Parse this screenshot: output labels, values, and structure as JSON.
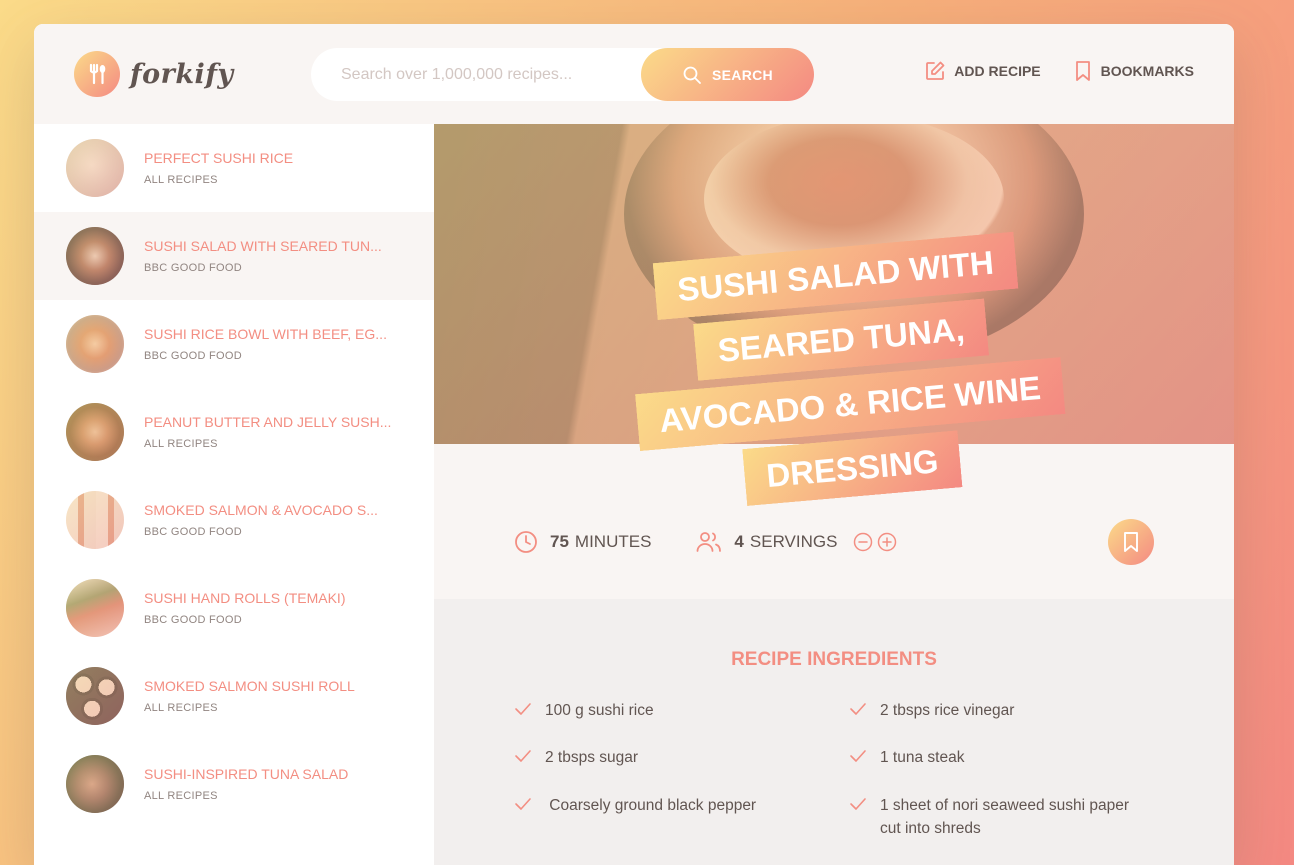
{
  "app": {
    "name": "forkify"
  },
  "colors": {
    "accent": "#f38e82",
    "gradient_start": "#fbdb89",
    "gradient_end": "#f48982",
    "text": "#615551"
  },
  "search": {
    "placeholder": "Search over 1,000,000 recipes...",
    "value": "",
    "button_label": "SEARCH",
    "icon": "search-icon"
  },
  "nav": [
    {
      "label": "ADD RECIPE",
      "icon": "edit-icon"
    },
    {
      "label": "BOOKMARKS",
      "icon": "bookmark-icon"
    }
  ],
  "results": [
    {
      "title": "PERFECT SUSHI RICE",
      "publisher": "ALL RECIPES",
      "active": false
    },
    {
      "title": "SUSHI SALAD WITH SEARED TUN...",
      "publisher": "BBC GOOD FOOD",
      "active": true
    },
    {
      "title": "SUSHI RICE BOWL WITH BEEF, EG...",
      "publisher": "BBC GOOD FOOD",
      "active": false
    },
    {
      "title": "PEANUT BUTTER AND JELLY SUSH...",
      "publisher": "ALL RECIPES",
      "active": false
    },
    {
      "title": "SMOKED SALMON & AVOCADO S...",
      "publisher": "BBC GOOD FOOD",
      "active": false
    },
    {
      "title": "SUSHI HAND ROLLS (TEMAKI)",
      "publisher": "BBC GOOD FOOD",
      "active": false
    },
    {
      "title": "SMOKED SALMON SUSHI ROLL",
      "publisher": "ALL RECIPES",
      "active": false
    },
    {
      "title": "SUSHI-INSPIRED TUNA SALAD",
      "publisher": "ALL RECIPES",
      "active": false
    }
  ],
  "recipe": {
    "title": "SUSHI SALAD WITH SEARED TUNA, AVOCADO & RICE WINE DRESSING",
    "cooking_time": "75",
    "cooking_time_unit": "MINUTES",
    "servings": "4",
    "servings_unit": "SERVINGS",
    "ingredients_heading": "RECIPE INGREDIENTS",
    "ingredients": [
      "100 g sushi rice",
      "2 tbsps rice vinegar",
      "2 tbsps sugar",
      "1 tuna steak",
      " Coarsely ground black pepper",
      "1 sheet of nori seaweed sushi paper cut into shreds"
    ]
  }
}
